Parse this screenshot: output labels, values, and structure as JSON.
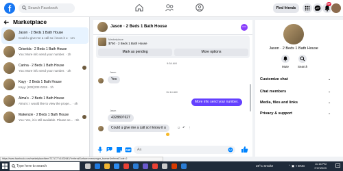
{
  "topbar": {
    "logo_letter": "f",
    "search_placeholder": "Search Facebook",
    "find_friends_label": "Find friends",
    "notification_count": "9+"
  },
  "sidebar": {
    "title": "Marketplace",
    "conversations": [
      {
        "name": "Jason · 2 Beds 1 Bath House",
        "preview": "Could u give me a call so i know it u · 1m"
      },
      {
        "name": "Griselda · 2 Beds 1 Bath House",
        "preview": "You: More info send your number. · 1h"
      },
      {
        "name": "Carina · 2 Beds 1 Bath House",
        "preview": "You: More info send your number. · 2h"
      },
      {
        "name": "Kayy · 2 Beds 1 Bath House",
        "preview": "Kayy: (832)232-0226 · 1h"
      },
      {
        "name": "Alma's · 2 Beds 1 Bath House",
        "preview": "Alma's: I would like to view the prope... · 4h"
      },
      {
        "name": "Makenzie · 2 Beds 1 Bath House",
        "preview": "You: Yes, it is still available. Please se... · 5h"
      }
    ]
  },
  "chat": {
    "title": "Jason · 2 Beds 1 Bath House",
    "listing_source": "Marketplace",
    "listing_price": "$750 · 2 Beds 1 Bath House",
    "mark_pending_label": "Mark as pending",
    "more_options_label": "More options",
    "messages": {
      "time1": "9:54 AM",
      "sender1": "Jason",
      "msg1": "Yes",
      "time2": "11:14 AM",
      "out1": "More info send your number.",
      "sender2": "Jason",
      "msg2": "4328807627",
      "msg3": "Could u give me a call so I know it u"
    },
    "composer_placeholder": "Aa"
  },
  "info": {
    "title": "Jason · 2 Beds 1 Bath House",
    "mute_label": "Mute",
    "search_label": "Search",
    "sections": [
      "Customize chat",
      "Chat members",
      "Media, files and links",
      "Privacy & support"
    ]
  },
  "status_url": "https://www.facebook.com/marketplace/item/727177741532643/?referralSurface=messenger_banner&referralCode=2",
  "taskbar": {
    "search_placeholder": "Type here to search",
    "weather": "28°C  Smoke",
    "time": "11:16 PM",
    "date": "7/17/2023"
  },
  "colors": {
    "brand": "#1877f2",
    "accent": "#6440ff",
    "active_row": "#e7f3ff"
  }
}
